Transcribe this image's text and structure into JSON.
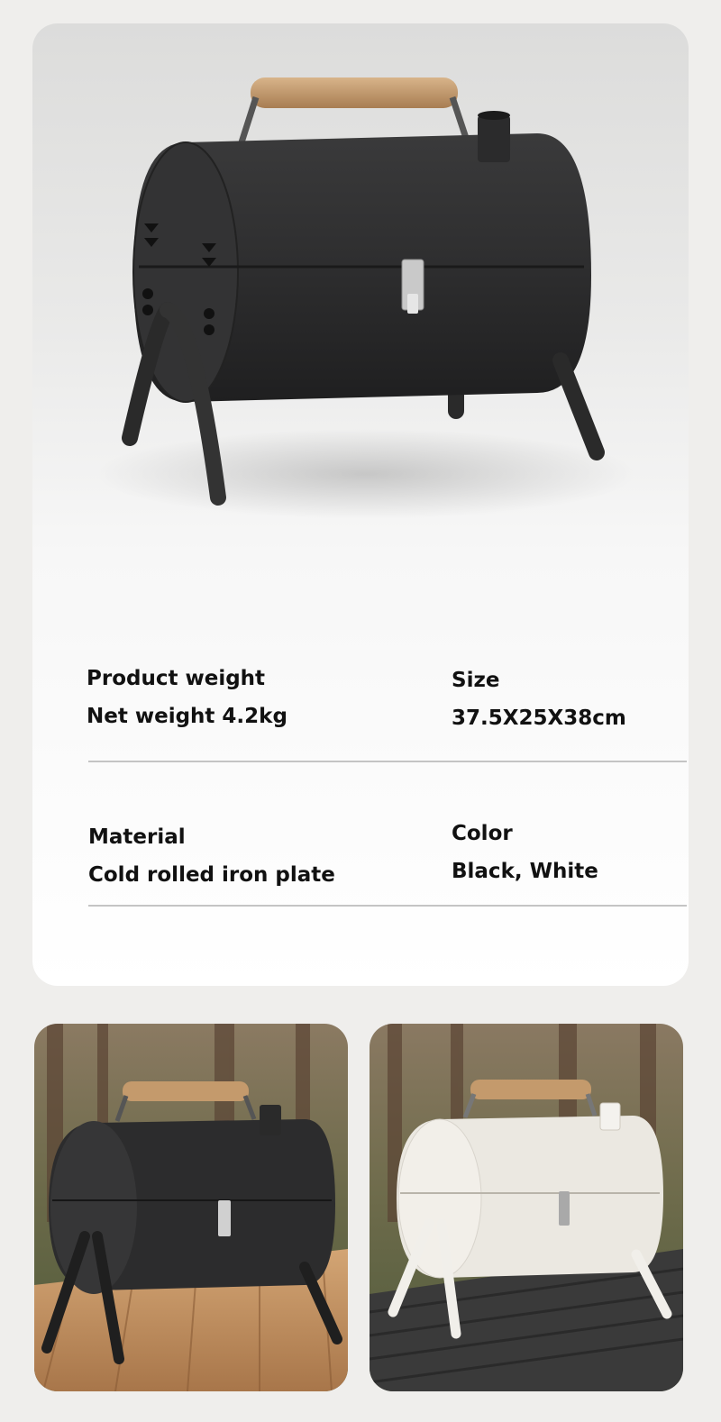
{
  "specs": {
    "weight": {
      "label": "Product weight",
      "value": "Net weight 4.2kg"
    },
    "size": {
      "label": "Size",
      "value": "37.5X25X38cm"
    },
    "material": {
      "label": "Material",
      "value": "Cold rolled iron plate"
    },
    "color": {
      "label": "Color",
      "value": "Black, White"
    }
  },
  "colors": {
    "grill_black": "#2c2c2d",
    "grill_white": "#ebe8e1",
    "wood_handle": "#c49a6c",
    "text": "#111111"
  },
  "images": {
    "hero": "grill-black-product-render",
    "left_photo": "grill-black-on-wood-table",
    "right_photo": "grill-white-on-dark-table"
  }
}
